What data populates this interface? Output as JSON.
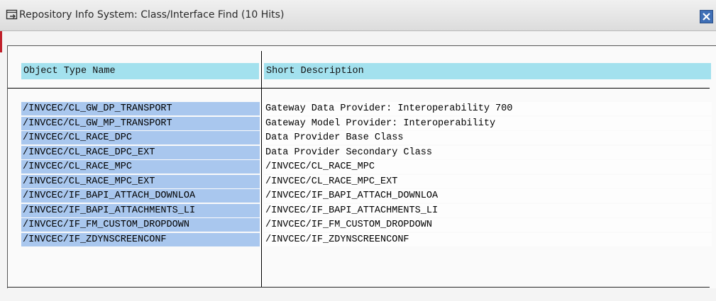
{
  "window": {
    "title": "Repository Info System: Class/Interface Find (10 Hits)",
    "title_icon": "new-window-arrow-icon",
    "close_icon": "close-icon",
    "accent_color": "#3f6fb6"
  },
  "table": {
    "columns": [
      "Object Type Name",
      "Short Description"
    ],
    "header_bg": "#a3e1ee",
    "key_cell_bg": "#a9c7ee",
    "rows": [
      {
        "name": "/INVCEC/CL_GW_DP_TRANSPORT",
        "description": "Gateway Data Provider: Interoperability 700"
      },
      {
        "name": "/INVCEC/CL_GW_MP_TRANSPORT",
        "description": "Gateway Model Provider: Interoperability"
      },
      {
        "name": "/INVCEC/CL_RACE_DPC",
        "description": "Data Provider Base Class"
      },
      {
        "name": "/INVCEC/CL_RACE_DPC_EXT",
        "description": "Data Provider Secondary Class"
      },
      {
        "name": "/INVCEC/CL_RACE_MPC",
        "description": "/INVCEC/CL_RACE_MPC"
      },
      {
        "name": "/INVCEC/CL_RACE_MPC_EXT",
        "description": "/INVCEC/CL_RACE_MPC_EXT"
      },
      {
        "name": "/INVCEC/IF_BAPI_ATTACH_DOWNLOA",
        "description": "/INVCEC/IF_BAPI_ATTACH_DOWNLOA"
      },
      {
        "name": "/INVCEC/IF_BAPI_ATTACHMENTS_LI",
        "description": "/INVCEC/IF_BAPI_ATTACHMENTS_LI"
      },
      {
        "name": "/INVCEC/IF_FM_CUSTOM_DROPDOWN",
        "description": "/INVCEC/IF_FM_CUSTOM_DROPDOWN"
      },
      {
        "name": "/INVCEC/IF_ZDYNSCREENCONF",
        "description": "/INVCEC/IF_ZDYNSCREENCONF"
      }
    ]
  }
}
